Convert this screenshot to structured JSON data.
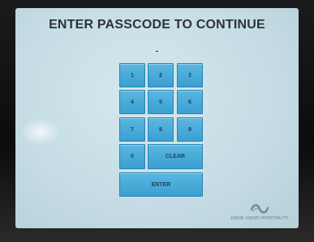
{
  "screen": {
    "title": "ENTER PASSCODE TO CONTINUE",
    "passcode_display": "-"
  },
  "keypad": {
    "keys": [
      "1",
      "2",
      "3",
      "4",
      "5",
      "6",
      "7",
      "8",
      "9",
      "0"
    ],
    "clear_label": "CLEAR",
    "enter_label": "ENTER"
  },
  "branding": {
    "logo_icon": "infinity-wave-icon",
    "logo_text": "ENGIE VIEWS HOSPITALITY"
  },
  "colors": {
    "screen_bg": "#c6dde5",
    "key_bg": "#3a9fd1",
    "title_text": "#2c3338"
  }
}
